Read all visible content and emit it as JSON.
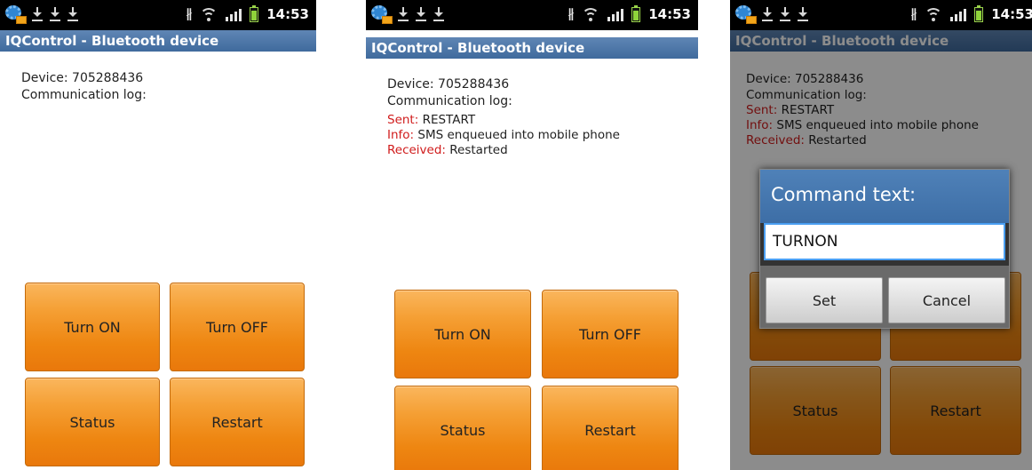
{
  "status_bar": {
    "time": "14:53"
  },
  "app": {
    "title": "IQControl - Bluetooth device"
  },
  "screens": [
    {
      "device_label": "Device: 705288436",
      "log_label": "Communication log:",
      "log": []
    },
    {
      "device_label": "Device: 705288436",
      "log_label": "Communication log:",
      "log": [
        {
          "kind": "Sent:",
          "text": " RESTART"
        },
        {
          "kind": "Info:",
          "text": " SMS enqueued into mobile phone"
        },
        {
          "kind": "Received:",
          "text": " Restarted"
        }
      ]
    },
    {
      "device_label": "Device: 705288436",
      "log_label": "Communication log:",
      "log": [
        {
          "kind": "Sent:",
          "text": " RESTART"
        },
        {
          "kind": "Info:",
          "text": " SMS enqueued into mobile phone"
        },
        {
          "kind": "Received:",
          "text": " Restarted"
        }
      ]
    }
  ],
  "buttons": {
    "turn_on": "Turn ON",
    "turn_off": "Turn OFF",
    "status": "Status",
    "restart": "Restart"
  },
  "dialog": {
    "title": "Command text:",
    "input_value": "TURNON",
    "set_label": "Set",
    "cancel_label": "Cancel"
  },
  "icons": {
    "status_left": [
      "app-notification-icon",
      "download-icon",
      "download-icon",
      "download-icon"
    ],
    "status_right": [
      "bluetooth-icon",
      "wifi-icon",
      "signal-icon",
      "battery-icon"
    ]
  },
  "colors": {
    "title_bar": "#4f79ab",
    "button_orange": "#f19322",
    "log_key": "#d01c1c",
    "dialog_title": "#4676ae",
    "input_focus": "#4a9ef1"
  }
}
